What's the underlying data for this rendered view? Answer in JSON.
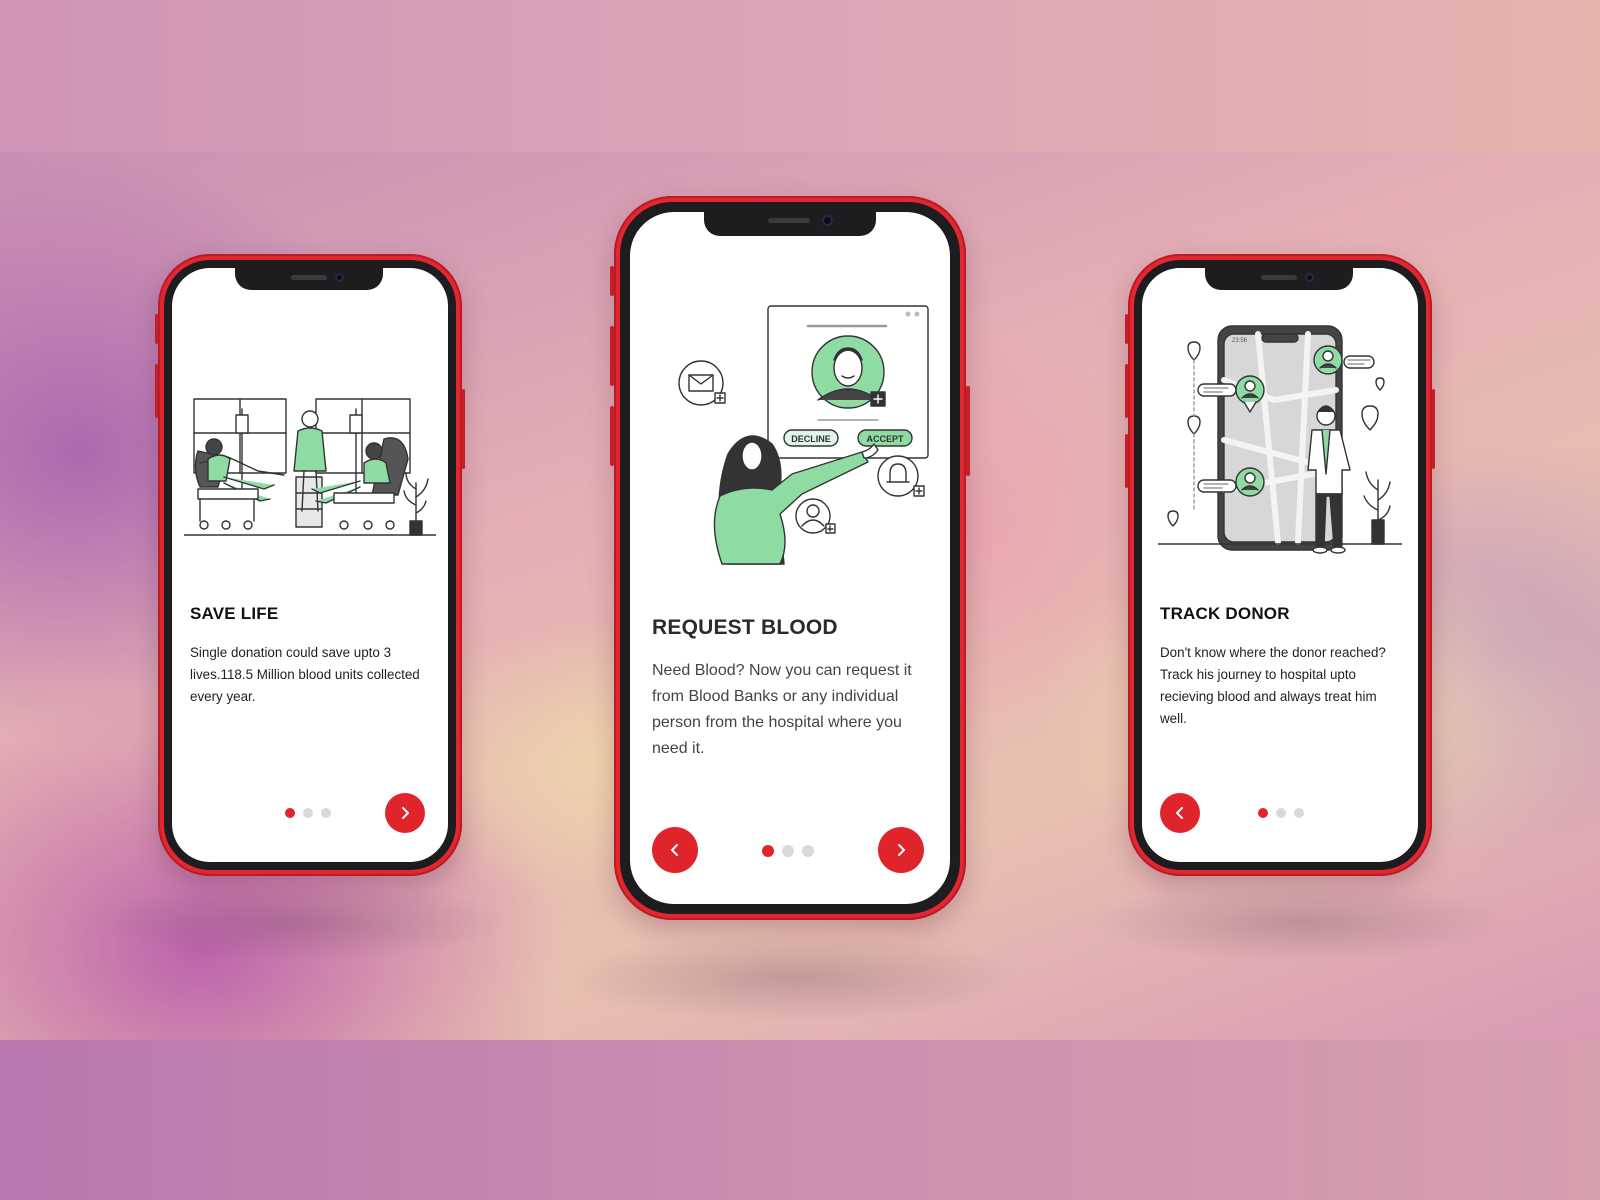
{
  "screens": [
    {
      "title": "SAVE LIFE",
      "description": "Single donation could save upto 3 lives.118.5 Million blood units collected every year.",
      "pager": {
        "active": 1,
        "total": 3
      },
      "next_icon": "chevron-right-icon"
    },
    {
      "title": "REQUEST BLOOD",
      "description": "Need Blood? Now you can request it from Blood Banks or any individual person from the hospital where you need it.",
      "pager": {
        "active": 1,
        "total": 3
      },
      "prev_icon": "chevron-left-icon",
      "next_icon": "chevron-right-icon",
      "illustration": {
        "decline_label": "DECLINE",
        "accept_label": "ACCEPT"
      }
    },
    {
      "title": "TRACK DONOR",
      "description": "Don't know where the donor reached? Track his journey to hospital upto recieving blood and always treat him well.",
      "pager": {
        "active": 1,
        "total": 3
      },
      "prev_icon": "chevron-left-icon",
      "map_phone_clock": "23:56"
    }
  ],
  "colors": {
    "brand_red": "#e0242c",
    "illustration_green": "#8edca3",
    "dot_inactive": "#d9d9d9"
  }
}
